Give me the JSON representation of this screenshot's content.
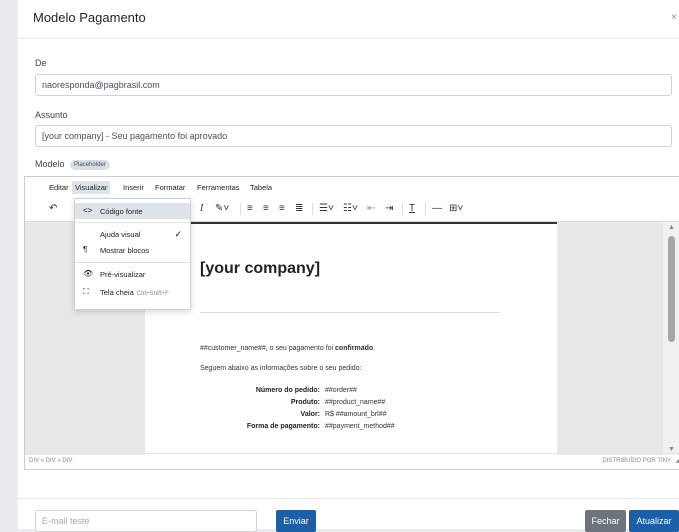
{
  "modal": {
    "title": "Modelo Pagamento",
    "close_label": "×"
  },
  "form": {
    "de_label": "De",
    "de_value": "naoresponda@pagbrasil.com",
    "assunto_label": "Assunto",
    "assunto_value": "[your company] - Seu pagamento foi aprovado",
    "modelo_label": "Modelo",
    "placeholder_badge": "Placeholder"
  },
  "editor": {
    "menus": [
      "Editar",
      "Visualizar",
      "Inserir",
      "Formatar",
      "Ferramentas",
      "Tabela"
    ],
    "active_menu": "Visualizar",
    "view_menu": {
      "items": [
        {
          "icon": "<>",
          "label": "Código fonte"
        },
        {
          "icon": "",
          "label": "Ajuda visual",
          "check": "✓"
        },
        {
          "icon": "¶",
          "label": "Mostrar blocos"
        },
        {
          "icon": "👁",
          "label": "Pré-visualizar"
        },
        {
          "icon": "⛶",
          "label": "Tela cheia",
          "shortcut": "Ctrl+Shift+F"
        }
      ]
    },
    "status_path": "DIV » DIV » DIV",
    "status_brand": "DISTRIBUÍDO POR TINY"
  },
  "document": {
    "company": "[your company]",
    "line1_pre": "##customer_name##, o seu pagamento foi ",
    "line1_bold": "confirmado",
    "line1_post": ".",
    "line2": "Seguem abaixo as informações sobre o seu pedido:",
    "rows": [
      {
        "label": "Número do pedido:",
        "value": "##order##"
      },
      {
        "label": "Produto:",
        "value": "##product_name##"
      },
      {
        "label": "Valor:",
        "value": "R$ ##amount_brl##"
      },
      {
        "label": "Forma de pagamento:",
        "value": "##payment_method##"
      }
    ]
  },
  "footer": {
    "test_email_placeholder": "E-mail teste",
    "send_label": "Enviar",
    "close_label": "Fechar",
    "update_label": "Atualizar"
  },
  "colors": {
    "primary": "#1b5fa8",
    "secondary": "#6c757d"
  }
}
